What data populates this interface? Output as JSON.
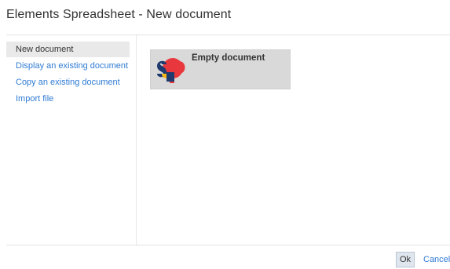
{
  "dialog": {
    "title": "Elements Spreadsheet - New document"
  },
  "sidebar": {
    "items": [
      {
        "label": "New document",
        "active": true
      },
      {
        "label": "Display an existing document",
        "active": false
      },
      {
        "label": "Copy an existing document",
        "active": false
      },
      {
        "label": "Import file",
        "active": false
      }
    ]
  },
  "main": {
    "template_tile": {
      "label": "Empty document",
      "icon": "sp-logo-icon"
    }
  },
  "footer": {
    "ok_label": "Ok",
    "cancel_label": "Cancel"
  },
  "colors": {
    "accent_link": "#2f7bd4",
    "logo_red": "#e8383d",
    "logo_navy": "#1f3a6e",
    "logo_yellow": "#f4b41a"
  }
}
